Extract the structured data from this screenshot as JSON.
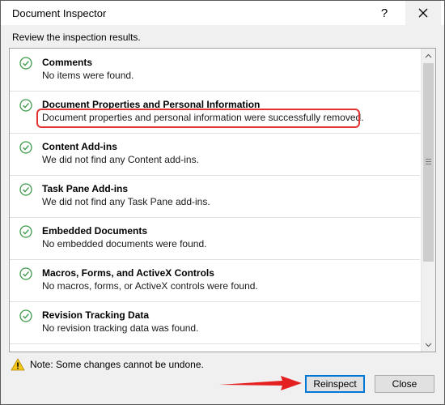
{
  "window": {
    "title": "Document Inspector",
    "help_label": "?",
    "close_icon": "close-icon"
  },
  "instruction": "Review the inspection results.",
  "results": [
    {
      "title": "Comments",
      "description": "No items were found."
    },
    {
      "title": "Document Properties and Personal Information",
      "description": "Document properties and personal information were successfully removed."
    },
    {
      "title": "Content Add-ins",
      "description": "We did not find any Content add-ins."
    },
    {
      "title": "Task Pane Add-ins",
      "description": "We did not find any Task Pane add-ins."
    },
    {
      "title": "Embedded Documents",
      "description": "No embedded documents were found."
    },
    {
      "title": "Macros, Forms, and ActiveX Controls",
      "description": "No macros, forms, or ActiveX controls were found."
    },
    {
      "title": "Revision Tracking Data",
      "description": "No revision tracking data was found."
    },
    {
      "title": "",
      "description": ""
    }
  ],
  "footer": {
    "note": "Note: Some changes cannot be undone.",
    "reinspect_label": "Reinspect",
    "close_label": "Close"
  },
  "colors": {
    "check": "#3d9a4a",
    "highlight": "#e23232",
    "arrow": "#e52020",
    "focus": "#0078d7"
  }
}
